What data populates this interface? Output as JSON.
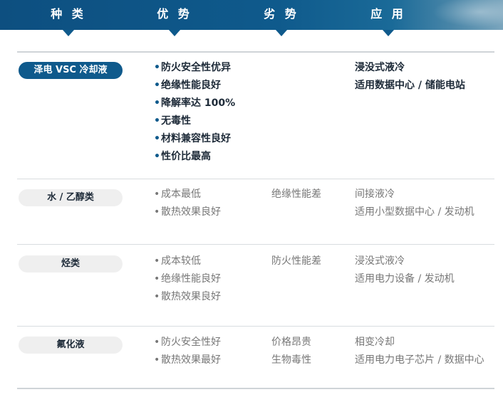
{
  "header": {
    "col_type": "种 类",
    "col_pros": "优 势",
    "col_cons": "劣 势",
    "col_app": "应 用",
    "color": "#0f5a8c"
  },
  "rows": [
    {
      "name": "泽电 VSC 冷却液",
      "pros": [
        "防火安全性优异",
        "绝缘性能良好",
        "降解率达 100%",
        "无毒性",
        "材料兼容性良好",
        "性价比最高"
      ],
      "cons": [],
      "app": [
        "浸没式液冷",
        "适用数据中心 / 储能电站"
      ]
    },
    {
      "name": "水 / 乙醇类",
      "pros": [
        "成本最低",
        "散热效果良好"
      ],
      "cons": [
        "绝缘性能差"
      ],
      "app": [
        "间接液冷",
        "适用小型数据中心 / 发动机"
      ]
    },
    {
      "name": "烃类",
      "pros": [
        "成本较低",
        "绝缘性能良好",
        "散热效果良好"
      ],
      "cons": [
        "防火性能差"
      ],
      "app": [
        "浸没式液冷",
        "适用电力设备 / 发动机"
      ]
    },
    {
      "name": "氟化液",
      "pros": [
        "防火安全性好",
        "散热效果最好"
      ],
      "cons": [
        "价格昂贵",
        "生物毒性"
      ],
      "app": [
        "相变冷却",
        "适用电力电子芯片 / 数据中心"
      ]
    }
  ]
}
